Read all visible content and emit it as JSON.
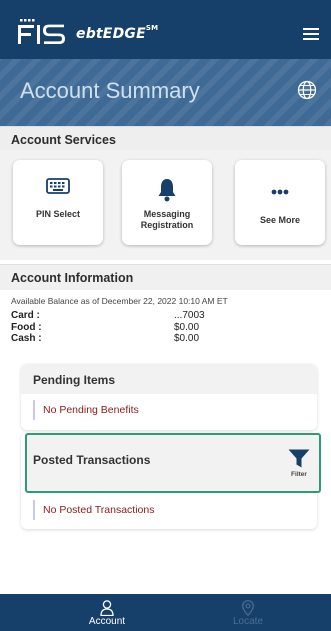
{
  "header": {
    "logo_brand": "FIS",
    "logo_product": "ebtEDGE",
    "logo_mark": "SM",
    "menu_icon": "hamburger-menu-icon"
  },
  "banner": {
    "title": "Account Summary",
    "language_icon": "globe-icon"
  },
  "account_services": {
    "heading": "Account Services",
    "cards": [
      {
        "label": "PIN Select",
        "icon": "keyboard-icon"
      },
      {
        "label": "Messaging Registration",
        "icon": "bell-icon"
      },
      {
        "label": "See More",
        "icon": "more-dots-icon"
      }
    ]
  },
  "account_information": {
    "heading": "Account Information",
    "balance_date": "Available Balance as of December 22, 2022 10:10 AM ET",
    "rows": [
      {
        "label": "Card :",
        "value": "...7003"
      },
      {
        "label": "Food :",
        "value": "$0.00"
      },
      {
        "label": "Cash :",
        "value": "$0.00"
      }
    ]
  },
  "pending": {
    "heading": "Pending Items",
    "message": "No Pending Benefits"
  },
  "posted": {
    "heading": "Posted Transactions",
    "filter_label": "Filter",
    "filter_icon": "filter-funnel-icon",
    "message": "No Posted Transactions"
  },
  "bottom_nav": {
    "items": [
      {
        "label": "Account",
        "icon": "person-icon",
        "active": true
      },
      {
        "label": "Locate",
        "icon": "location-pin-icon",
        "active": false
      }
    ]
  },
  "colors": {
    "header_bg": "#163f6a",
    "banner_bg": "#3f6a96",
    "highlight_border": "#2e9a7a",
    "empty_message": "#8b1a1a"
  }
}
